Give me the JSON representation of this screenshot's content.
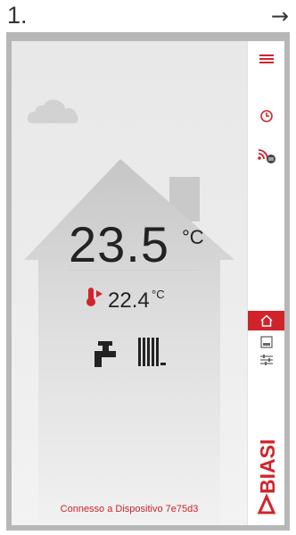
{
  "slide": {
    "step_number": "1.",
    "next_arrow": "→"
  },
  "thermostat": {
    "room_temperature": "23.5",
    "room_unit": "°C",
    "outdoor_temperature": "22.4",
    "outdoor_unit": "°C"
  },
  "status": {
    "connection_text": "Connesso a Dispositivo 7e75d3"
  },
  "sidebar": {
    "items": [
      {
        "name": "menu",
        "icon": "hamburger-menu-icon"
      },
      {
        "name": "schedule",
        "icon": "clock-icon"
      },
      {
        "name": "remote",
        "icon": "remote-connection-icon"
      },
      {
        "name": "home",
        "icon": "home-icon",
        "active": true
      },
      {
        "name": "panel",
        "icon": "panel-icon"
      },
      {
        "name": "settings",
        "icon": "sliders-icon"
      }
    ]
  },
  "brand": {
    "logo_text": "BIASI"
  },
  "colors": {
    "accent": "#d1242a",
    "frame": "#b7b7b7",
    "background": "#ececec"
  }
}
